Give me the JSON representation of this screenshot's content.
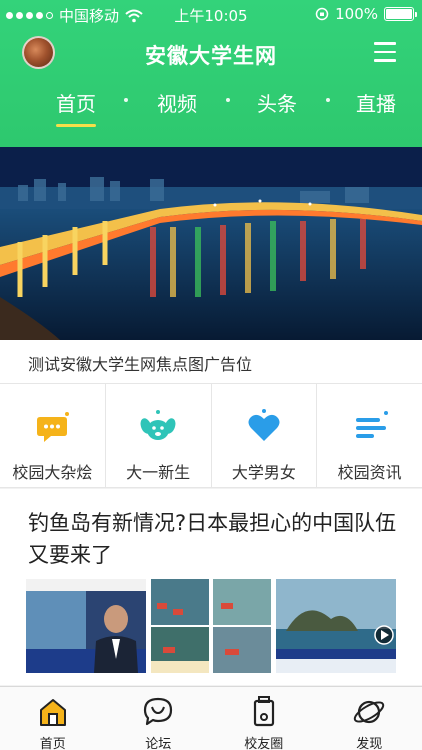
{
  "status_bar": {
    "carrier": "中国移动",
    "time": "上午10:05",
    "battery": "100%",
    "battery_level": 1.0
  },
  "header": {
    "title": "安徽大学生网",
    "tabs": [
      {
        "label": "首页",
        "active": true
      },
      {
        "label": "视频",
        "active": false
      },
      {
        "label": "头条",
        "active": false
      },
      {
        "label": "直播",
        "active": false
      }
    ]
  },
  "banner": {
    "caption": "测试安徽大学生网焦点图广告位"
  },
  "quick_links": [
    {
      "label": "校园大杂烩",
      "icon": "chat-bubble-icon",
      "color": "#f5b31a"
    },
    {
      "label": "大一新生",
      "icon": "puppy-icon",
      "color": "#2fc4b8"
    },
    {
      "label": "大学男女",
      "icon": "heart-icon",
      "color": "#2a9de8"
    },
    {
      "label": "校园资讯",
      "icon": "news-lines-icon",
      "color": "#2a9de8"
    }
  ],
  "article": {
    "title": "钓鱼岛有新情况?日本最担心的中国队伍又要来了"
  },
  "tab_bar": {
    "items": [
      {
        "label": "首页",
        "icon": "home-icon",
        "active": true
      },
      {
        "label": "论坛",
        "icon": "forum-icon",
        "active": false
      },
      {
        "label": "校友圈",
        "icon": "alumni-icon",
        "active": false
      },
      {
        "label": "发现",
        "icon": "planet-icon",
        "active": false
      }
    ]
  },
  "colors": {
    "header_green": "#33d37a",
    "tab_indicator": "#f7df4a",
    "active_tab_icon": "#f5b31a"
  }
}
